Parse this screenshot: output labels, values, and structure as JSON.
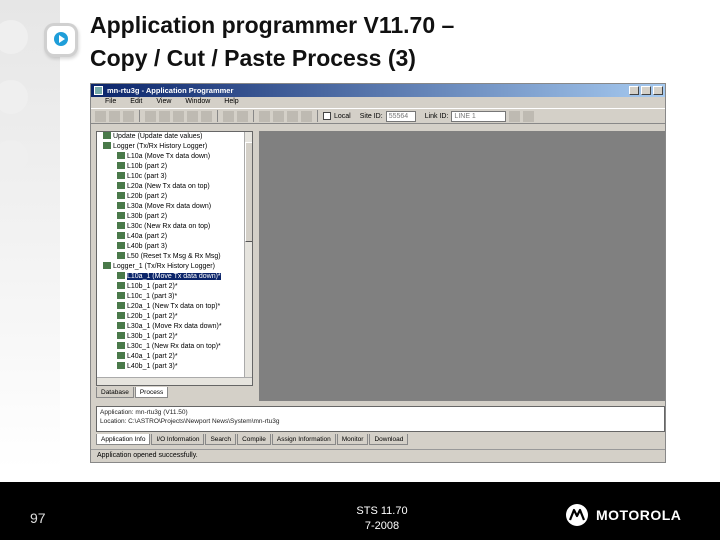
{
  "title": {
    "line1": "Application programmer V11.70 –",
    "line2": "Copy / Cut / Paste Process (3)"
  },
  "window": {
    "title": "mn-rtu3g - Application Programmer",
    "menu": [
      "File",
      "Edit",
      "View",
      "Window",
      "Help"
    ],
    "toolbar": {
      "local_label": "Local",
      "site_id_label": "Site ID:",
      "site_id_value": "55564",
      "link_id_label": "Link ID:",
      "link_id_value": "LINE 1"
    },
    "tree": [
      {
        "text": "Update (Update date values)",
        "level": 0
      },
      {
        "text": "Logger (Tx/Rx History Logger)",
        "level": 0
      },
      {
        "text": "L10a (Move Tx data down)",
        "level": 1
      },
      {
        "text": "L10b (part 2)",
        "level": 1
      },
      {
        "text": "L10c (part 3)",
        "level": 1
      },
      {
        "text": "L20a (New Tx data on top)",
        "level": 1
      },
      {
        "text": "L20b (part 2)",
        "level": 1
      },
      {
        "text": "L30a (Move Rx data down)",
        "level": 1
      },
      {
        "text": "L30b (part 2)",
        "level": 1
      },
      {
        "text": "L30c (New Rx data on top)",
        "level": 1
      },
      {
        "text": "L40a (part 2)",
        "level": 1
      },
      {
        "text": "L40b (part 3)",
        "level": 1
      },
      {
        "text": "L50 (Reset Tx Msg & Rx Msg)",
        "level": 1
      },
      {
        "text": "Logger_1 (Tx/Rx History Logger)",
        "level": 0
      },
      {
        "text": "L10a_1 (Move Tx data down)*",
        "level": 1,
        "selected": true
      },
      {
        "text": "L10b_1 (part 2)*",
        "level": 1
      },
      {
        "text": "L10c_1 (part 3)*",
        "level": 1
      },
      {
        "text": "L20a_1 (New Tx data on top)*",
        "level": 1
      },
      {
        "text": "L20b_1 (part 2)*",
        "level": 1
      },
      {
        "text": "L30a_1 (Move Rx data down)*",
        "level": 1
      },
      {
        "text": "L30b_1 (part 2)*",
        "level": 1
      },
      {
        "text": "L30c_1 (New Rx data on top)*",
        "level": 1
      },
      {
        "text": "L40a_1 (part 2)*",
        "level": 1
      },
      {
        "text": "L40b_1 (part 3)*",
        "level": 1
      }
    ],
    "tree_tabs": [
      "Database",
      "Process"
    ],
    "log_lines": [
      "Application: mn-rtu3g (V11.50)",
      "Location: C:\\ASTRO\\Projects\\Newport News\\System\\mn-rtu3g"
    ],
    "bottom_tabs": [
      "Application Info",
      "I/O Information",
      "Search",
      "Compile",
      "Assign Information",
      "Monitor",
      "Download"
    ],
    "status": "Application opened successfully."
  },
  "footer": {
    "page": "97",
    "line1": "STS 11.70",
    "line2": "7-2008",
    "brand": "MOTOROLA"
  },
  "colors": {
    "titlebar": "#0a246a",
    "footer_bg": "#000000",
    "workspace": "#808080",
    "logo_blue": "#1f9ed9"
  }
}
